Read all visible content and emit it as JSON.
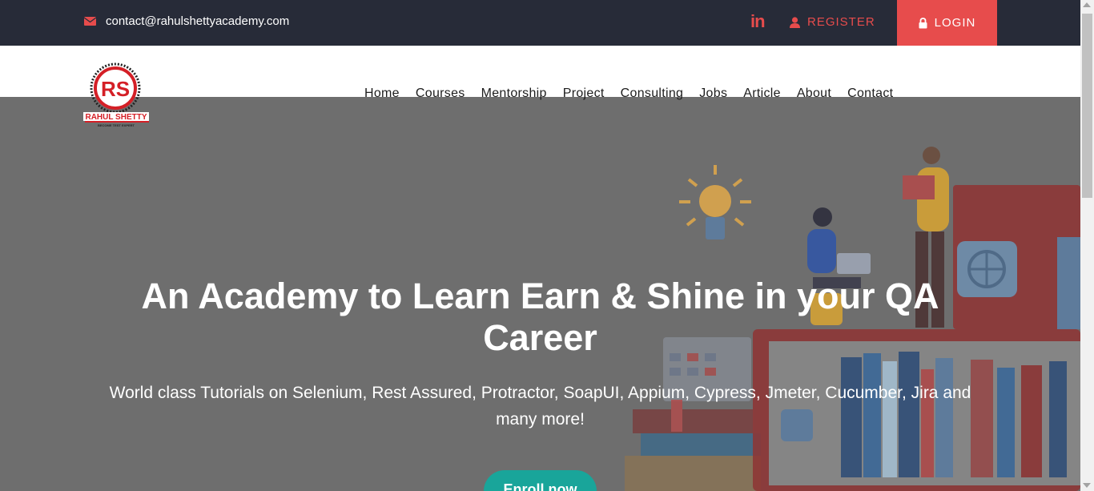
{
  "topbar": {
    "email": "contact@rahulshettyacademy.com",
    "linkedin_label": "in",
    "register_label": "REGISTER",
    "login_label": "LOGIN"
  },
  "nav": {
    "items": [
      "Home",
      "Courses",
      "Mentorship",
      "Project",
      "Consulting",
      "Jobs",
      "Article",
      "About",
      "Contact"
    ]
  },
  "hero": {
    "title_line1": "An Academy to Learn Earn & Shine in your QA",
    "title_line2": "Career",
    "subtitle_line1": "World class Tutorials on Selenium, Rest Assured, Protractor, SoapUI, Appium, Cypress, Jmeter, Cucumber, Jira and",
    "subtitle_line2": "many more!",
    "cta_label": "Enroll now"
  },
  "logo": {
    "text": "RAHUL SHETTY",
    "tagline": "BECOME TEST EXPERT"
  },
  "colors": {
    "topbar_bg": "#272b38",
    "accent": "#e74c4c",
    "hero_overlay": "#6e6e6e",
    "cta": "#19a59a"
  },
  "icons": [
    "envelope-icon",
    "linkedin-icon",
    "user-icon",
    "lock-icon"
  ]
}
